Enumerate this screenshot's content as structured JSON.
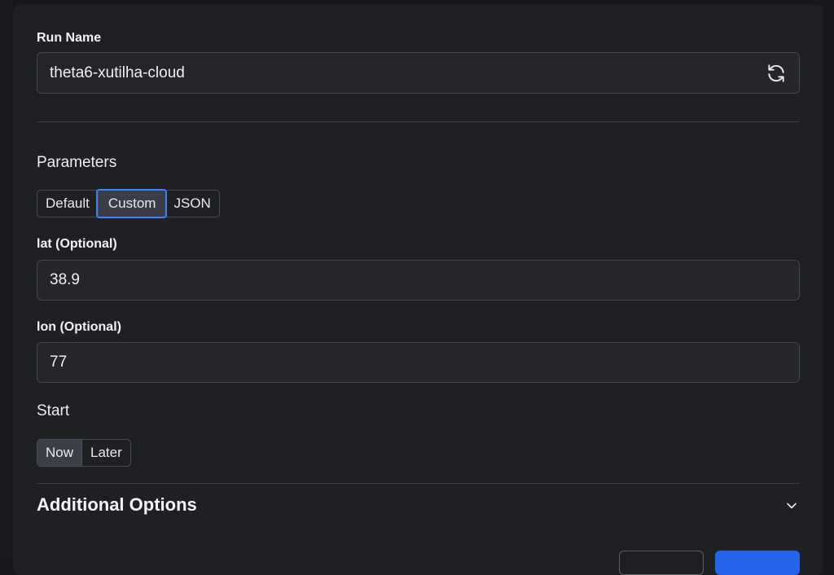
{
  "run_name": {
    "label": "Run Name",
    "value": "theta6-xutilha-cloud",
    "refresh_icon": "refresh-icon"
  },
  "parameters": {
    "label": "Parameters",
    "modes": [
      "Default",
      "Custom",
      "JSON"
    ],
    "selected_mode": "Custom"
  },
  "fields": {
    "lat": {
      "label": "lat (Optional)",
      "value": "38.9"
    },
    "lon": {
      "label": "lon (Optional)",
      "value": "77"
    }
  },
  "start": {
    "label": "Start",
    "options": [
      "Now",
      "Later"
    ],
    "selected": "Now"
  },
  "additional_options": {
    "title": "Additional Options",
    "icon": "chevron-down-icon"
  },
  "colors": {
    "accent": "#3b82f6",
    "primary_button": "#2563eb",
    "panel_bg": "#1f2024"
  }
}
